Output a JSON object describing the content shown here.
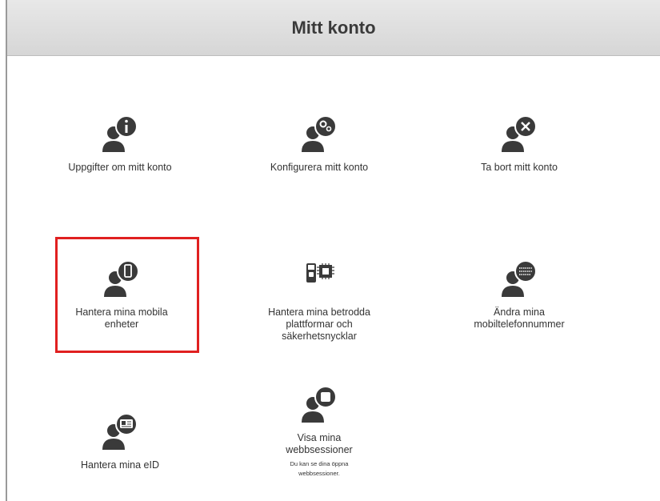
{
  "header": {
    "title": "Mitt konto"
  },
  "tiles": [
    {
      "label": "Uppgifter om mitt konto",
      "icon": "user-info-icon"
    },
    {
      "label": "Konfigurera mitt konto",
      "icon": "user-settings-icon"
    },
    {
      "label": "Ta bort mitt konto",
      "icon": "user-delete-icon"
    },
    {
      "label": "Hantera mina mobila enheter",
      "icon": "user-mobile-icon"
    },
    {
      "label": "Hantera mina betrodda plattformar och säkerhetsnycklar",
      "icon": "security-keys-icon"
    },
    {
      "label": "Ändra mina mobiltelefonnummer",
      "icon": "user-phone-number-icon"
    },
    {
      "label": "Hantera mina eID",
      "icon": "user-eid-icon"
    },
    {
      "label": "Visa mina webbsessioner",
      "sub": "Du kan se dina öppna webbsessioner.",
      "icon": "user-session-icon"
    }
  ],
  "colors": {
    "icon": "#3a3a3a",
    "highlight": "#e02020",
    "header_bg": "#dcdcdc"
  }
}
